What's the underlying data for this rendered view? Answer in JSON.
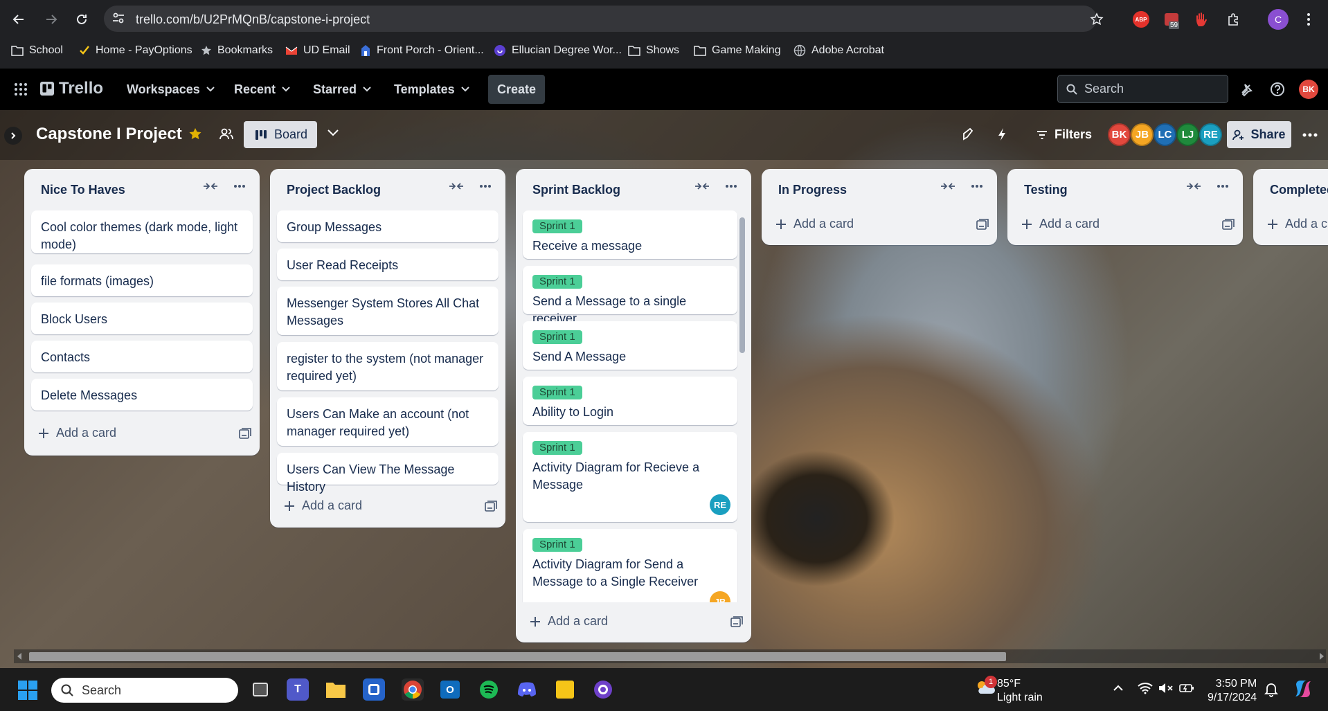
{
  "browser": {
    "url": "trello.com/b/U2PrMQnB/capstone-i-project",
    "extension_badge": "59",
    "profile_initial": "C",
    "abp_label": "ABP",
    "bookmarks": [
      "School",
      "Home - PayOptions",
      "Bookmarks",
      "UD Email",
      "Front Porch - Orient...",
      "Ellucian Degree Wor...",
      "Shows",
      "Game Making",
      "Adobe Acrobat"
    ]
  },
  "trello": {
    "logo": "Trello",
    "nav": [
      "Workspaces",
      "Recent",
      "Starred",
      "Templates"
    ],
    "create_label": "Create",
    "search_placeholder": "Search",
    "user_initials": "BK"
  },
  "board": {
    "title": "Capstone I Project",
    "view_label": "Board",
    "filters_label": "Filters",
    "share_label": "Share",
    "members": [
      {
        "initials": "BK",
        "color": "#e2483d"
      },
      {
        "initials": "JB",
        "color": "#f5a623"
      },
      {
        "initials": "LC",
        "color": "#1f6fb5"
      },
      {
        "initials": "LJ",
        "color": "#1f8a3c"
      },
      {
        "initials": "RE",
        "color": "#1a9fc0"
      }
    ]
  },
  "lists": [
    {
      "title": "Nice To Haves",
      "cards": [
        "Cool color themes (dark mode, light mode)",
        "file formats (images)",
        "Block Users",
        "Contacts",
        "Delete Messages"
      ],
      "add_label": "Add a card"
    },
    {
      "title": "Project Backlog",
      "cards": [
        "Group Messages",
        "User Read Receipts",
        "Messenger System Stores All Chat Messages",
        "register to the system (not manager required yet)",
        "Users Can Make an account (not manager required yet)",
        "Users Can View The Message History"
      ],
      "add_label": "Add a card"
    },
    {
      "title": "Sprint Backlog",
      "label": "Sprint 1",
      "cards": [
        "Receive a message",
        "Send a Message to a single receiver",
        "Send A Message",
        "Ability to Login",
        "Activity Diagram for Recieve a Message",
        "Activity Diagram for Send a Message to a Single Receiver"
      ],
      "card_avatars": [
        "RE",
        "JB"
      ],
      "add_label": "Add a card"
    },
    {
      "title": "In Progress",
      "add_label": "Add a card"
    },
    {
      "title": "Testing",
      "add_label": "Add a card"
    },
    {
      "title": "Completed",
      "add_label": "Add a c"
    }
  ],
  "taskbar": {
    "search_placeholder": "Search",
    "weather_temp": "85°F",
    "weather_desc": "Light rain",
    "weather_badge": "1",
    "time": "3:50 PM",
    "date": "9/17/2024"
  }
}
